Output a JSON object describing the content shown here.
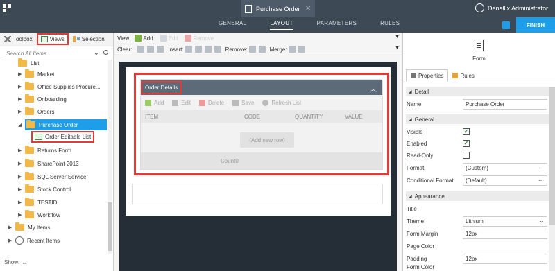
{
  "topbar": {
    "doc_title": "Purchase Order",
    "user_name": "Denallix Administrator",
    "nav": [
      "GENERAL",
      "LAYOUT",
      "PARAMETERS",
      "RULES"
    ],
    "active_nav": "LAYOUT",
    "finish_label": "FINISH"
  },
  "left": {
    "tabs": {
      "toolbox": "Toolbox",
      "views": "Views",
      "selection": "Selection"
    },
    "search_placeholder": "Search All Items",
    "tree": [
      {
        "label": "List"
      },
      {
        "label": "Market"
      },
      {
        "label": "Office Supplies Procure..."
      },
      {
        "label": "Onboarding"
      },
      {
        "label": "Orders"
      },
      {
        "label": "Purchase Order"
      },
      {
        "label": "Order Editable List"
      },
      {
        "label": "Returns Form"
      },
      {
        "label": "SharePoint 2013"
      },
      {
        "label": "SQL Server Service"
      },
      {
        "label": "Stock Control"
      },
      {
        "label": "TESTID"
      },
      {
        "label": "Workflow"
      },
      {
        "label": "My Items"
      },
      {
        "label": "Recent Items"
      }
    ],
    "footer": "Show: ..."
  },
  "toolbar": {
    "view_label": "View:",
    "add_label": "Add",
    "edit_label": "Edit",
    "remove_label": "Remove",
    "clear_label": "Clear:",
    "insert_label": "Insert:",
    "remove2_label": "Remove:",
    "merge_label": "Merge:"
  },
  "panel": {
    "title": "Order Details",
    "actions": {
      "add": "Add",
      "edit": "Edit",
      "delete": "Delete",
      "save": "Save",
      "refresh": "Refresh List"
    },
    "columns": [
      "ITEM",
      "CODE",
      "QUANTITY",
      "VALUE"
    ],
    "add_row": "(Add new row)",
    "count": "Count0"
  },
  "right": {
    "header": "Form",
    "tabs": {
      "properties": "Properties",
      "rules": "Rules"
    },
    "sections": {
      "detail": "Detail",
      "general": "General",
      "appearance": "Appearance"
    },
    "props": {
      "name_label": "Name",
      "name_value": "Purchase Order",
      "visible_label": "Visible",
      "enabled_label": "Enabled",
      "readonly_label": "Read-Only",
      "format_label": "Format",
      "format_value": "(Custom)",
      "cond_label": "Conditional Format",
      "cond_value": "(Default)",
      "title_label": "Title",
      "theme_label": "Theme",
      "theme_value": "Lithium",
      "margin_label": "Form Margin",
      "margin_value": "12px",
      "pagecolor_label": "Page Color",
      "padding_label": "Padding",
      "padding_value": "12px",
      "formcolor_label": "Form Color"
    }
  }
}
